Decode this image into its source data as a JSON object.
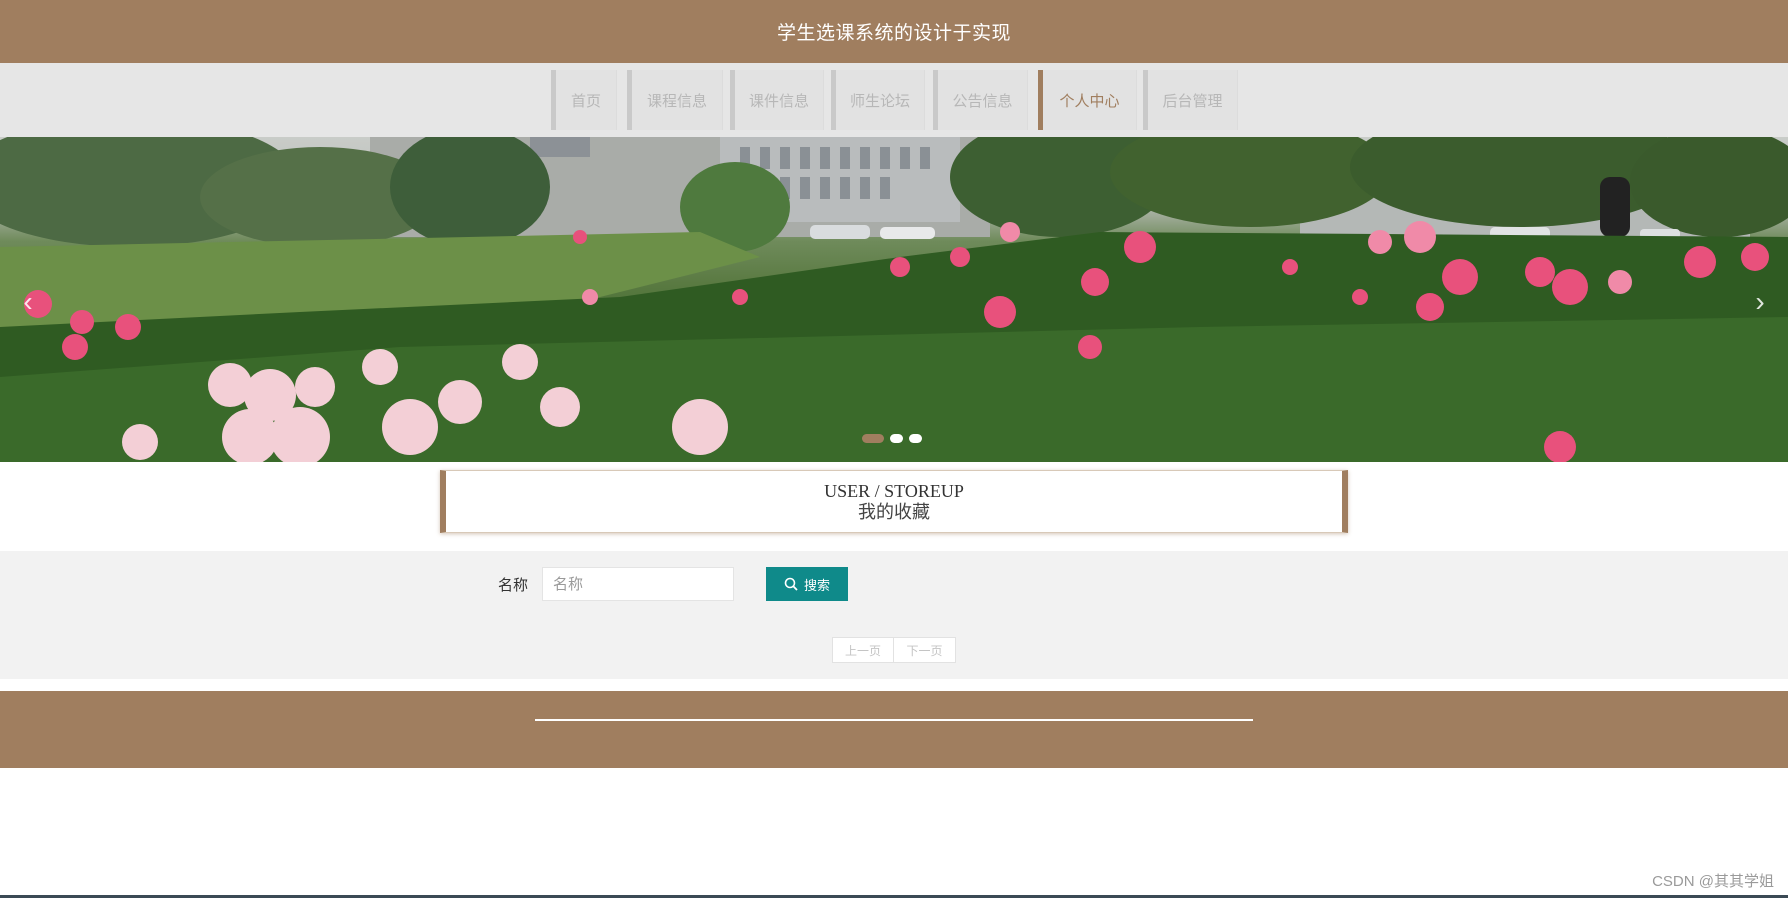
{
  "header": {
    "title": "学生选课系统的设计于实现"
  },
  "nav": {
    "items": [
      {
        "label": "首页"
      },
      {
        "label": "课程信息"
      },
      {
        "label": "课件信息"
      },
      {
        "label": "师生论坛"
      },
      {
        "label": "公告信息"
      },
      {
        "label": "个人中心",
        "active": true
      },
      {
        "label": "后台管理"
      }
    ]
  },
  "banner": {
    "prev_icon": "chevron-left-icon",
    "next_icon": "chevron-right-icon",
    "slide_count": 3,
    "active_slide": 1
  },
  "section": {
    "title_en": "USER / STOREUP",
    "title_cn": "我的收藏"
  },
  "search": {
    "label": "名称",
    "placeholder": "名称",
    "value": "",
    "button_label": "搜索",
    "button_icon": "search-icon"
  },
  "pager": {
    "prev_label": "上一页",
    "next_label": "下一页"
  },
  "watermark": "CSDN @其其学姐",
  "colors": {
    "brand": "#a07e5f",
    "nav_bg": "#e6e6e6",
    "search_button": "#0f8a8a",
    "nav_text": "#b7b7b7"
  }
}
